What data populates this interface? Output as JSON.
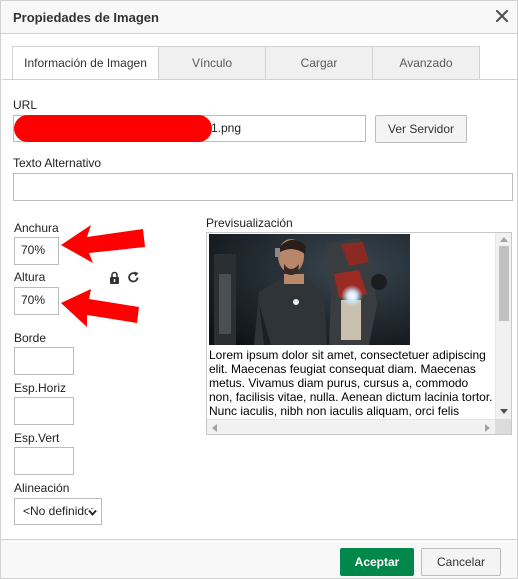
{
  "dialog": {
    "title": "Propiedades de Imagen",
    "close_icon": "close-icon"
  },
  "tabs": [
    {
      "label": "Información de Imagen",
      "active": true
    },
    {
      "label": "Vínculo",
      "active": false
    },
    {
      "label": "Cargar",
      "active": false
    },
    {
      "label": "Avanzado",
      "active": false
    }
  ],
  "url": {
    "label": "URL",
    "value_visible": "1.png",
    "browse_label": "Ver Servidor"
  },
  "alt_text": {
    "label": "Texto Alternativo",
    "value": ""
  },
  "width": {
    "label": "Anchura",
    "value": "70%"
  },
  "height": {
    "label": "Altura",
    "value": "70%"
  },
  "lock_icon": "lock-icon",
  "reset_icon": "reset-size-icon",
  "border": {
    "label": "Borde",
    "value": ""
  },
  "hspace": {
    "label": "Esp.Horiz",
    "value": ""
  },
  "vspace": {
    "label": "Esp.Vert",
    "value": ""
  },
  "align": {
    "label": "Alineación",
    "selected": "<No definido>"
  },
  "preview": {
    "label": "Previsualización",
    "text": "Lorem ipsum dolor sit amet, consectetuer adipiscing elit. Maecenas feugiat consequat diam. Maecenas metus. Vivamus diam purus, cursus a, commodo non, facilisis vitae, nulla. Aenean dictum lacinia tortor. Nunc iaculis, nibh non iaculis aliquam, orci felis"
  },
  "footer": {
    "ok_label": "Aceptar",
    "cancel_label": "Cancelar"
  },
  "colors": {
    "accent_ok": "#00884b",
    "annotation": "#ff0000"
  }
}
